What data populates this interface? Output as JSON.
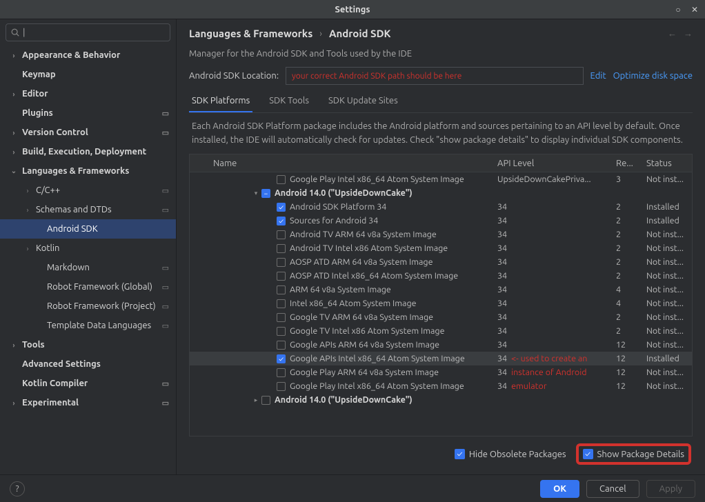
{
  "window": {
    "title": "Settings"
  },
  "sidebar": {
    "search_placeholder": "",
    "items": [
      {
        "label": "Appearance & Behavior",
        "level": 1,
        "chev": ">",
        "bold": true
      },
      {
        "label": "Keymap",
        "level": 1,
        "chev": "",
        "bold": true
      },
      {
        "label": "Editor",
        "level": 1,
        "chev": ">",
        "bold": true
      },
      {
        "label": "Plugins",
        "level": 1,
        "chev": "",
        "bold": true,
        "badge": "▭"
      },
      {
        "label": "Version Control",
        "level": 1,
        "chev": ">",
        "bold": true,
        "badge": "▭"
      },
      {
        "label": "Build, Execution, Deployment",
        "level": 1,
        "chev": ">",
        "bold": true
      },
      {
        "label": "Languages & Frameworks",
        "level": 1,
        "chev": "v",
        "bold": true
      },
      {
        "label": "C/C++",
        "level": 2,
        "chev": ">",
        "badge": "▭"
      },
      {
        "label": "Schemas and DTDs",
        "level": 2,
        "chev": ">",
        "badge": "▭"
      },
      {
        "label": "Android SDK",
        "level": 3,
        "chev": "",
        "selected": true
      },
      {
        "label": "Kotlin",
        "level": 2,
        "chev": ">"
      },
      {
        "label": "Markdown",
        "level": 3,
        "chev": "",
        "badge": "▭"
      },
      {
        "label": "Robot Framework (Global)",
        "level": 3,
        "chev": "",
        "badge": "▭"
      },
      {
        "label": "Robot Framework (Project)",
        "level": 3,
        "chev": "",
        "badge": "▭"
      },
      {
        "label": "Template Data Languages",
        "level": 3,
        "chev": "",
        "badge": "▭"
      },
      {
        "label": "Tools",
        "level": 1,
        "chev": ">",
        "bold": true
      },
      {
        "label": "Advanced Settings",
        "level": 1,
        "chev": "",
        "bold": true
      },
      {
        "label": "Kotlin Compiler",
        "level": 1,
        "chev": "",
        "bold": true,
        "badge": "▭"
      },
      {
        "label": "Experimental",
        "level": 1,
        "chev": ">",
        "bold": true,
        "badge": "▭"
      }
    ]
  },
  "breadcrumb": {
    "seg1": "Languages & Frameworks",
    "seg2": "Android SDK"
  },
  "description": "Manager for the Android SDK and Tools used by the IDE",
  "location": {
    "label": "Android SDK Location:",
    "value": "your correct Android SDK path should be here",
    "edit": "Edit",
    "optimize": "Optimize disk space"
  },
  "tabs": {
    "items": [
      {
        "label": "SDK Platforms",
        "active": true
      },
      {
        "label": "SDK Tools"
      },
      {
        "label": "SDK Update Sites"
      }
    ],
    "desc": "Each Android SDK Platform package includes the Android platform and sources pertaining to an API level by default. Once installed, the IDE will automatically check for updates. Check \"show package details\" to display individual SDK components."
  },
  "table": {
    "headers": {
      "name": "Name",
      "api": "API Level",
      "rev": "Re...",
      "status": "Status"
    },
    "rows": [
      {
        "indent": 92,
        "cb": "unchecked",
        "name": "Google Play Intel x86_64 Atom System Image",
        "api": "UpsideDownCakePriva...",
        "rev": "3",
        "status": "Not inst..."
      },
      {
        "indent": 56,
        "twisty": "▾",
        "cb": "indet",
        "name": "Android 14.0 (\"UpsideDownCake\")",
        "bold": true
      },
      {
        "indent": 92,
        "cb": "checked",
        "name": "Android SDK Platform 34",
        "api": "34",
        "rev": "2",
        "status": "Installed"
      },
      {
        "indent": 92,
        "cb": "checked",
        "name": "Sources for Android 34",
        "api": "34",
        "rev": "2",
        "status": "Installed"
      },
      {
        "indent": 92,
        "cb": "unchecked",
        "name": "Android TV ARM 64 v8a System Image",
        "api": "34",
        "rev": "2",
        "status": "Not inst..."
      },
      {
        "indent": 92,
        "cb": "unchecked",
        "name": "Android TV Intel x86 Atom System Image",
        "api": "34",
        "rev": "2",
        "status": "Not inst..."
      },
      {
        "indent": 92,
        "cb": "unchecked",
        "name": "AOSP ATD ARM 64 v8a System Image",
        "api": "34",
        "rev": "2",
        "status": "Not inst..."
      },
      {
        "indent": 92,
        "cb": "unchecked",
        "name": "AOSP ATD Intel x86_64 Atom System Image",
        "api": "34",
        "rev": "2",
        "status": "Not inst..."
      },
      {
        "indent": 92,
        "cb": "unchecked",
        "name": "ARM 64 v8a System Image",
        "api": "34",
        "rev": "4",
        "status": "Not inst..."
      },
      {
        "indent": 92,
        "cb": "unchecked",
        "name": "Intel x86_64 Atom System Image",
        "api": "34",
        "rev": "4",
        "status": "Not inst..."
      },
      {
        "indent": 92,
        "cb": "unchecked",
        "name": "Google TV ARM 64 v8a System Image",
        "api": "34",
        "rev": "2",
        "status": "Not inst..."
      },
      {
        "indent": 92,
        "cb": "unchecked",
        "name": "Google TV Intel x86 Atom System Image",
        "api": "34",
        "rev": "2",
        "status": "Not inst..."
      },
      {
        "indent": 92,
        "cb": "unchecked",
        "name": "Google APIs ARM 64 v8a System Image",
        "api": "34",
        "rev": "12",
        "status": "Not inst..."
      },
      {
        "indent": 92,
        "cb": "checked",
        "name": "Google APIs Intel x86_64 Atom System Image",
        "api": "34",
        "annot": "<- used to create an",
        "rev": "12",
        "status": "Installed",
        "sel": true
      },
      {
        "indent": 92,
        "cb": "unchecked",
        "name": "Google Play ARM 64 v8a System Image",
        "api": "34",
        "annot": "instance of Android",
        "rev": "12",
        "status": "Not inst..."
      },
      {
        "indent": 92,
        "cb": "unchecked",
        "name": "Google Play Intel x86_64 Atom System Image",
        "api": "34",
        "annot": "emulator",
        "rev": "12",
        "status": "Not inst..."
      },
      {
        "indent": 56,
        "twisty": "▸",
        "cb": "unchecked",
        "name": "Android 14.0 (\"UpsideDownCake\")",
        "bold": true
      }
    ]
  },
  "bottom": {
    "hide": "Hide Obsolete Packages",
    "show": "Show Package Details"
  },
  "footer": {
    "ok": "OK",
    "cancel": "Cancel",
    "apply": "Apply"
  }
}
